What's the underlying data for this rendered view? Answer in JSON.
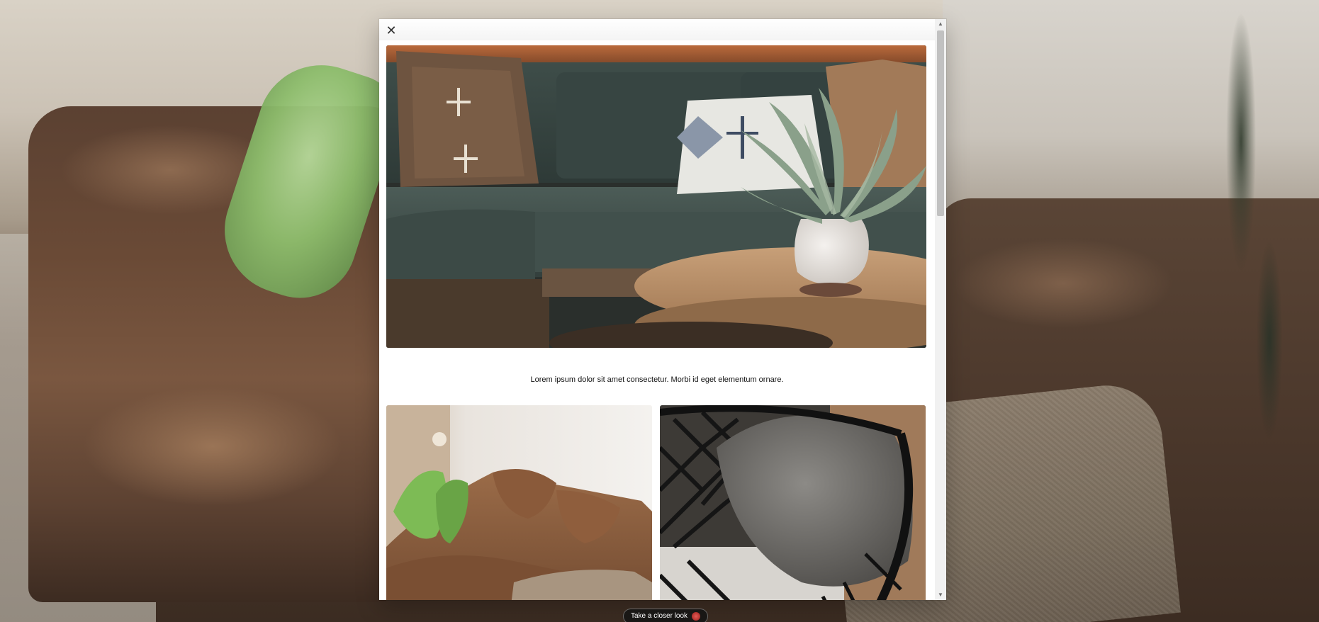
{
  "modal": {
    "close_icon": "close-icon",
    "close_glyph": "✕",
    "caption": "Lorem ipsum dolor sit amet consectetur. Morbi id eget elementum ornare.",
    "scrollbar": {
      "up_glyph": "▲",
      "down_glyph": "▼"
    }
  },
  "cta": {
    "label": "Take a closer look",
    "icon": "globe-icon"
  }
}
